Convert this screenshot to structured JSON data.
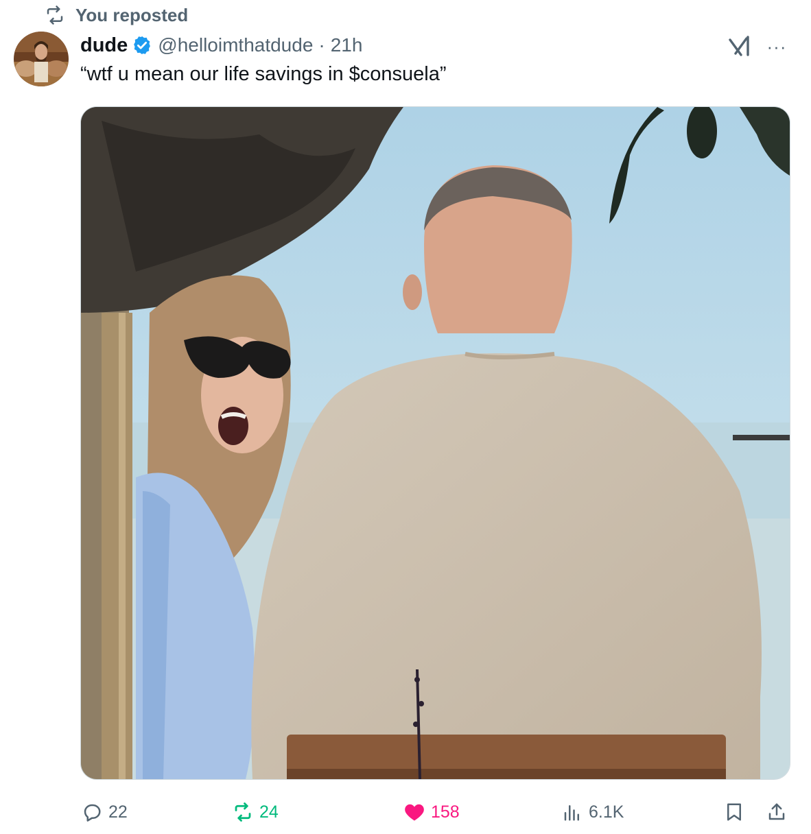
{
  "repost_banner": {
    "label": "You reposted",
    "icon": "repost-icon"
  },
  "author": {
    "name": "dude",
    "verified": true,
    "handle": "@helloimthatdude",
    "separator": "·",
    "time": "21h"
  },
  "tweet": {
    "text": "“wtf u mean our life savings in $consuela”"
  },
  "header_icons": {
    "grok": "grok-icon",
    "more": "···"
  },
  "actions": {
    "replies": "22",
    "reposts": "24",
    "likes": "158",
    "views": "6.1K"
  },
  "colors": {
    "text": "#0f1419",
    "secondary": "#536471",
    "verified": "#1d9bf0",
    "repost_active": "#00ba7c",
    "like_active": "#f91880",
    "border": "#cfd9de"
  }
}
